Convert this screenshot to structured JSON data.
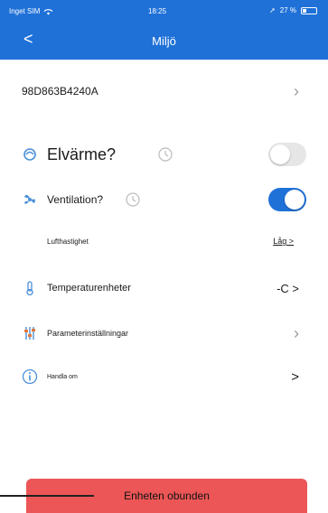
{
  "status_bar": {
    "carrier": "Inget SIM",
    "time": "18:25",
    "battery": "27 %"
  },
  "header": {
    "back_symbol": "<",
    "title": "Miljö"
  },
  "device": {
    "id": "98D863B4240A"
  },
  "settings": {
    "elvarme": {
      "label": "Elvärme?",
      "enabled": false
    },
    "ventilation": {
      "label": "Ventilation?",
      "enabled": true
    },
    "lufthastighet": {
      "label": "Lufthastighet",
      "value": "Låg >"
    },
    "temperaturenheter": {
      "label": "Temperaturenheter",
      "value": "-C >"
    },
    "parameter": {
      "label": "Parameterinställningar"
    },
    "handla_om": {
      "label": "Handla om",
      "value": ">"
    }
  },
  "footer": {
    "button_label": "Enheten obunden"
  },
  "colors": {
    "accent": "#1f71d8",
    "danger": "#ec5656"
  }
}
